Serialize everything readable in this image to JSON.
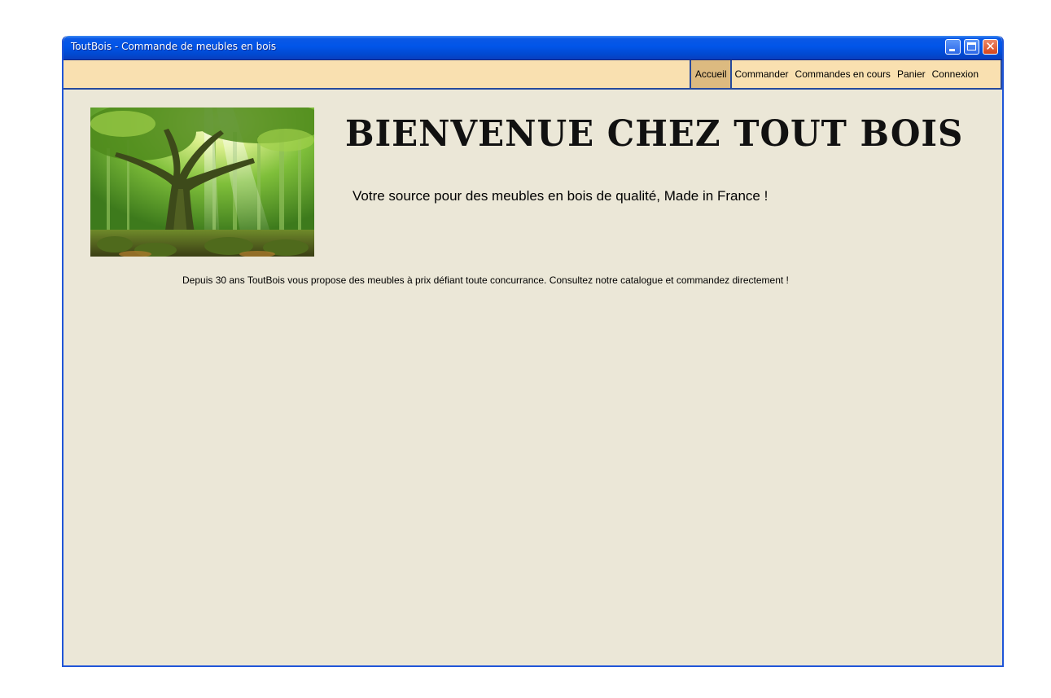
{
  "window": {
    "title": "ToutBois - Commande de meubles en bois",
    "controls": [
      "minimize-icon",
      "maximize-icon",
      "close-icon"
    ]
  },
  "menu": {
    "items": [
      {
        "label": "Accueil",
        "active": true
      },
      {
        "label": "Commander",
        "active": false
      },
      {
        "label": "Commandes en cours",
        "active": false
      },
      {
        "label": "Panier",
        "active": false
      },
      {
        "label": "Connexion",
        "active": false
      }
    ]
  },
  "home": {
    "headline": "BIENVENUE CHEZ TOUT BOIS",
    "tagline": "Votre source pour des meubles en bois de qualité, Made in France !",
    "description": "Depuis 30 ans ToutBois vous propose des meubles à prix défiant toute concurrance. Consultez notre catalogue et commandez directement !",
    "image": "forest-tree-photo"
  },
  "colors": {
    "titlebar": "#0155e8",
    "menubar": "#f9e0b0",
    "menu_active": "#dcba80",
    "content_bg": "#ebe7d7",
    "border": "#274a9c"
  }
}
